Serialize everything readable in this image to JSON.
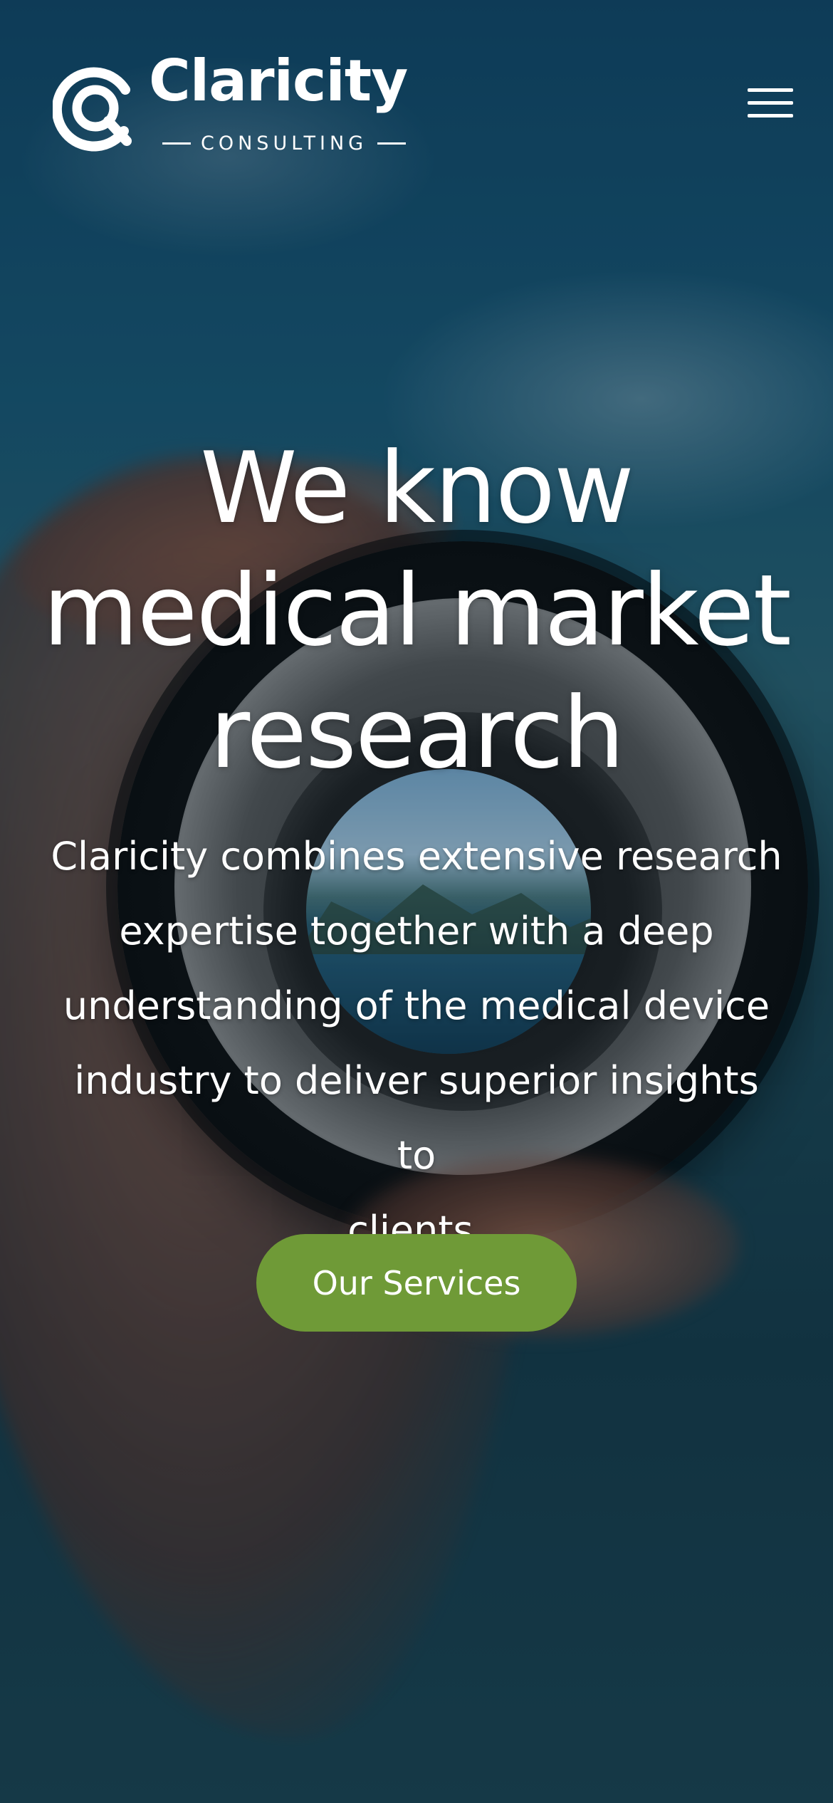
{
  "header": {
    "logo": {
      "title": "Claricity",
      "subtitle": "CONSULTING"
    },
    "menu_icon": "hamburger-menu-icon"
  },
  "hero": {
    "title_lines": [
      "We know",
      "medical market",
      "research"
    ],
    "description_lines": [
      "Claricity combines extensive research",
      "expertise together with a deep",
      "understanding of the medical device",
      "industry to deliver superior insights to",
      "clients."
    ],
    "cta_label": "Our Services",
    "background_image": "hand holding camera lens over lake"
  },
  "colors": {
    "accent": "#6f9a37",
    "text": "#ffffff",
    "sky": "#12496a"
  }
}
